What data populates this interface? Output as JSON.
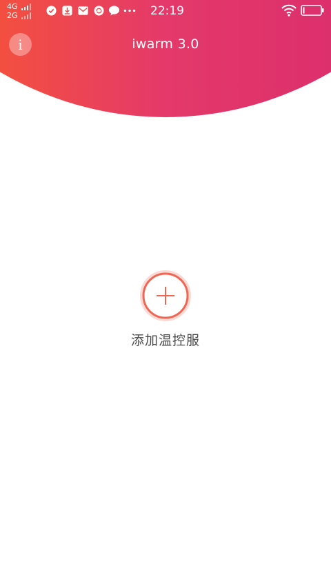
{
  "status_bar": {
    "network_1": "4G",
    "network_2": "2G",
    "time": "22:19",
    "notification_icons": [
      "check-circle-icon",
      "download-icon",
      "mail-icon",
      "sync-icon",
      "chat-bubble-icon",
      "more-dots-icon"
    ]
  },
  "header": {
    "title": "iwarm 3.0",
    "info_icon_glyph": "i",
    "gradient_colors": [
      "#f4503e",
      "#dc2f6c"
    ]
  },
  "main": {
    "add_label": "添加温控服",
    "accent_color": "#f06652"
  }
}
